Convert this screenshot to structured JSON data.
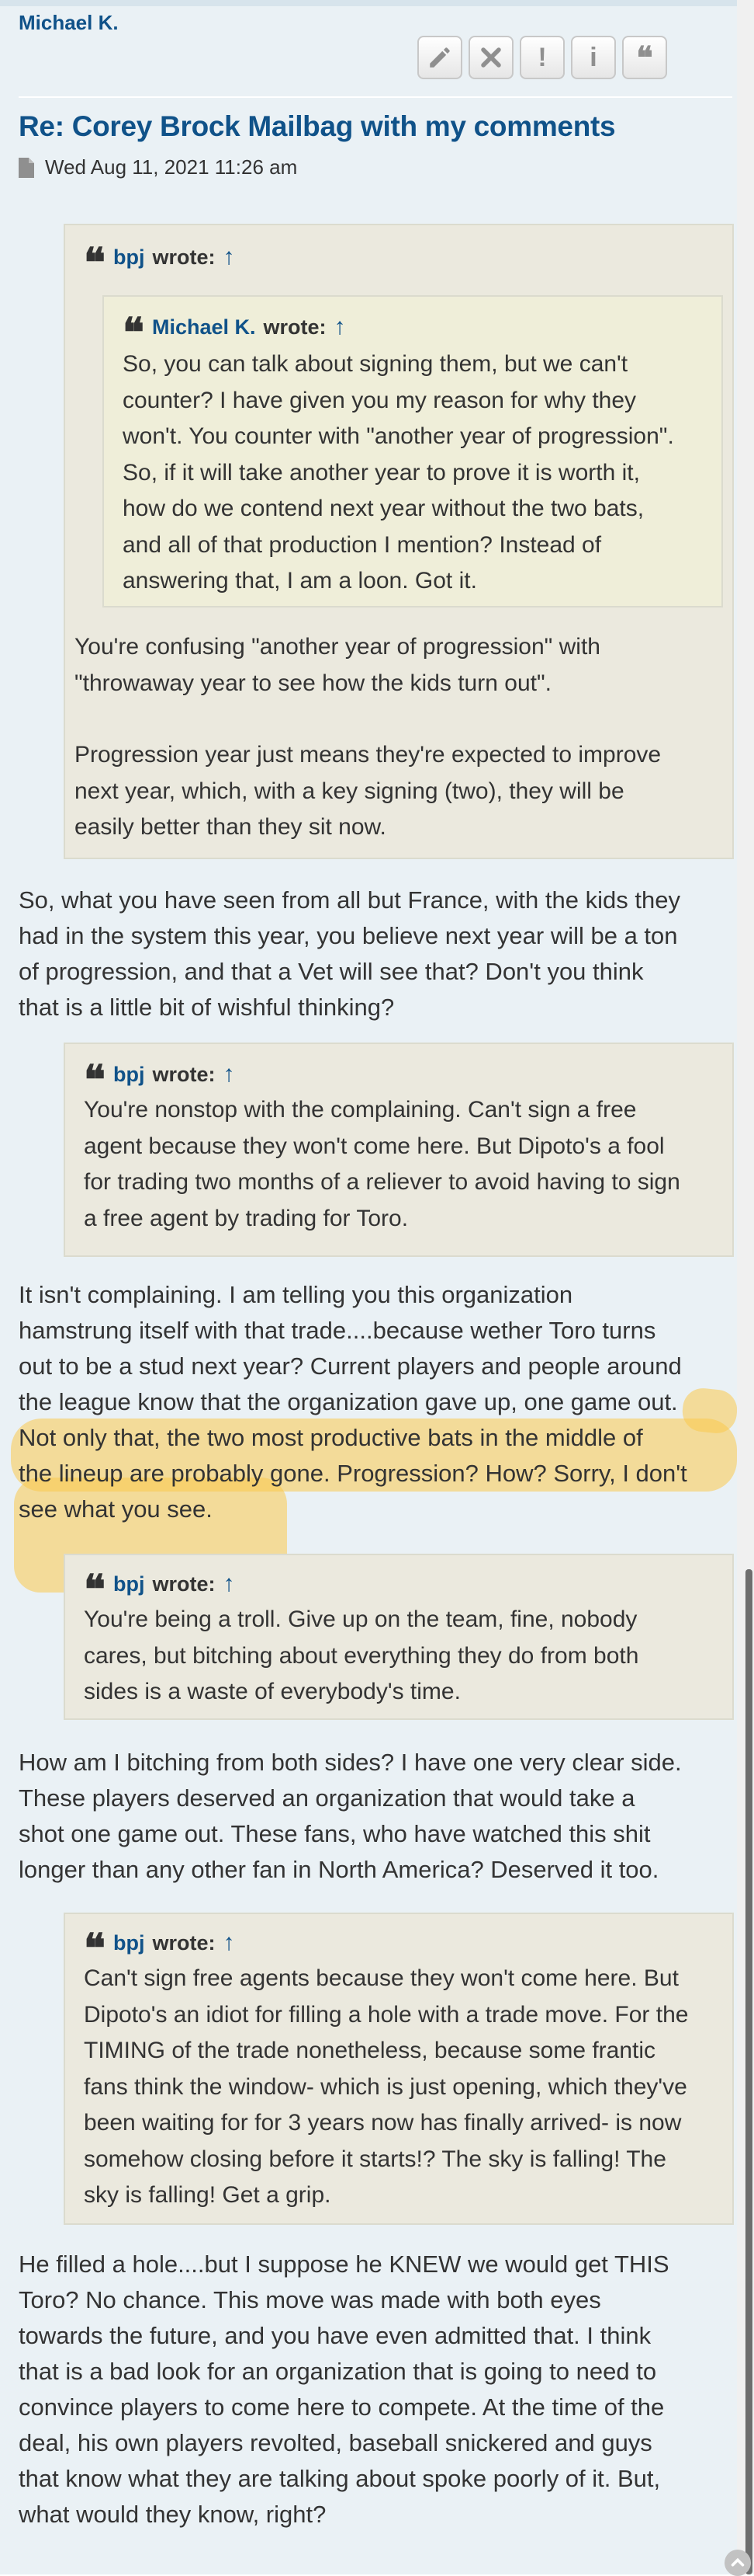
{
  "post": {
    "author": "Michael K.",
    "title": "Re: Corey Brock Mailbag with my comments",
    "date": "Wed Aug 11, 2021 11:26 am",
    "buttons": [
      {
        "name": "edit",
        "icon": "pencil-icon"
      },
      {
        "name": "delete",
        "icon": "close-icon"
      },
      {
        "name": "report",
        "icon": "exclamation-icon",
        "glyph": "!"
      },
      {
        "name": "info",
        "icon": "info-icon",
        "glyph": "i"
      },
      {
        "name": "quote",
        "icon": "quote-icon",
        "glyph": "❝"
      }
    ]
  },
  "quote1": {
    "author": "bpj",
    "wrote": "wrote:",
    "arrow": "↑",
    "nested": {
      "author": "Michael K.",
      "wrote": "wrote:",
      "arrow": "↑",
      "lines": [
        "So, you can talk about signing them, but we can't",
        "counter? I have given you my reason for why they",
        "won't. You counter with \"another year of progression\".",
        "So, if it will take another year to prove it is worth it,",
        "how do we contend next year without the two bats,",
        "and all of that production I mention? Instead of",
        "answering that, I am a loon. Got it."
      ]
    },
    "para1": [
      "You're confusing \"another year of progression\" with",
      "\"throwaway year to see how the kids turn out\"."
    ],
    "para2": [
      "Progression year just means they're expected to improve",
      "next year, which, with a key signing (two), they will be",
      "easily better than they sit now."
    ]
  },
  "reply1": [
    "So, what you have seen from all but France, with the kids they",
    "had in the system this year, you believe next year will be a ton",
    "of progression, and that a Vet will see that? Don't you think",
    "that is a little bit of wishful thinking?"
  ],
  "quote2": {
    "author": "bpj",
    "wrote": "wrote:",
    "arrow": "↑",
    "lines": [
      "You're nonstop with the complaining. Can't sign a free",
      "agent because they won't come here. But Dipoto's a fool",
      "for trading two months of a reliever to avoid having to sign",
      "a free agent by trading for Toro."
    ]
  },
  "reply2": [
    "It isn't complaining. I am telling you this organization",
    "hamstrung itself with that trade....because wether Toro turns",
    "out to be a stud next year? Current players and people around",
    "the league know that the organization gave up, one game out.",
    "Not only that, the two most productive bats in the middle of",
    "the lineup are probably gone. Progression? How? Sorry, I don't",
    "see what you see."
  ],
  "quote3": {
    "author": "bpj",
    "wrote": "wrote:",
    "arrow": "↑",
    "lines": [
      "You're being a troll. Give up on the team, fine, nobody",
      "cares, but bitching about everything they do from both",
      "sides is a waste of everybody's time."
    ]
  },
  "reply3": [
    "How am I bitching from both sides? I have one very clear side.",
    "These players deserved an organization that would take a",
    "shot one game out. These fans, who have watched this shit",
    "longer than any other fan in North America? Deserved it too."
  ],
  "quote4": {
    "author": "bpj",
    "wrote": "wrote:",
    "arrow": "↑",
    "lines": [
      "Can't sign free agents because they won't come here. But",
      "Dipoto's an idiot for filling a hole with a trade move. For the",
      "TIMING of the trade nonetheless, because some frantic",
      "fans think the window- which is just opening, which they've",
      "been waiting for for 3 years now has finally arrived- is now",
      "somehow closing before it starts!? The sky is falling! The",
      "sky is falling! Get a grip."
    ]
  },
  "reply4": [
    "He filled a hole....but I suppose he KNEW we would get THIS",
    "Toro? No chance. This move was made with both eyes",
    "towards the future, and you have even admitted that. I think",
    "that is a bad look for an organization that is going to need to",
    "convince players to come here to compete. At the time of the",
    "deal, his own players revolted, baseball snickered and guys",
    "that know what they are talking about spoke poorly of it. But,",
    "what would they know, right?"
  ],
  "back_to_top_icon": "chevron-up-icon",
  "colors": {
    "link": "#105289",
    "page_bg": "#eaf1f5",
    "quote_bg": "#ebe9de",
    "nested_quote_bg": "#efeed9",
    "highlight": "#f9c94c"
  }
}
